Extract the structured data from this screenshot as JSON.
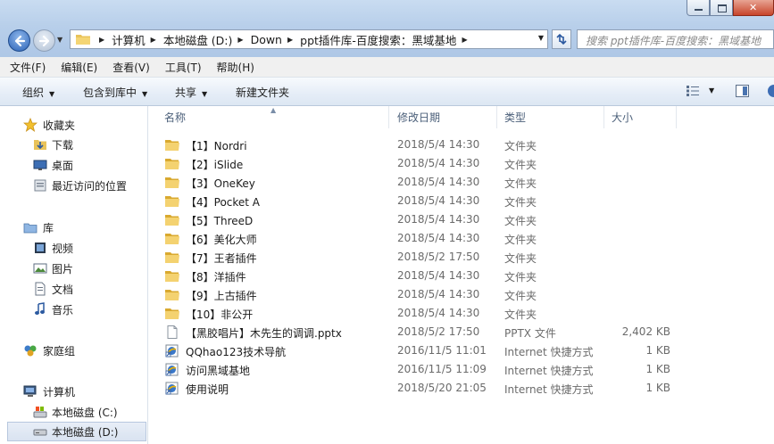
{
  "window": {
    "breadcrumb": [
      "计算机",
      "本地磁盘 (D:)",
      "Down",
      "ppt插件库-百度搜索：黑域基地"
    ],
    "search_placeholder": "搜索 ppt插件库-百度搜索：黑域基地"
  },
  "menubar": [
    "文件(F)",
    "编辑(E)",
    "查看(V)",
    "工具(T)",
    "帮助(H)"
  ],
  "toolbar": {
    "organize": "组织",
    "include_library": "包含到库中",
    "share": "共享",
    "new_folder": "新建文件夹"
  },
  "sidebar": {
    "favorites": "收藏夹",
    "downloads": "下载",
    "desktop": "桌面",
    "recent": "最近访问的位置",
    "libraries": "库",
    "videos": "视频",
    "pictures": "图片",
    "documents": "文档",
    "music": "音乐",
    "homegroup": "家庭组",
    "computer": "计算机",
    "drive_c": "本地磁盘 (C:)",
    "drive_d": "本地磁盘 (D:)"
  },
  "columns": {
    "name": "名称",
    "date": "修改日期",
    "type": "类型",
    "size": "大小"
  },
  "files": [
    {
      "name": "【1】Nordri",
      "date": "2018/5/4 14:30",
      "type": "文件夹",
      "size": "",
      "icon": "folder-icon"
    },
    {
      "name": "【2】iSlide",
      "date": "2018/5/4 14:30",
      "type": "文件夹",
      "size": "",
      "icon": "folder-icon"
    },
    {
      "name": "【3】OneKey",
      "date": "2018/5/4 14:30",
      "type": "文件夹",
      "size": "",
      "icon": "folder-icon"
    },
    {
      "name": "【4】Pocket A",
      "date": "2018/5/4 14:30",
      "type": "文件夹",
      "size": "",
      "icon": "folder-icon"
    },
    {
      "name": "【5】ThreeD",
      "date": "2018/5/4 14:30",
      "type": "文件夹",
      "size": "",
      "icon": "folder-icon"
    },
    {
      "name": "【6】美化大师",
      "date": "2018/5/4 14:30",
      "type": "文件夹",
      "size": "",
      "icon": "folder-icon"
    },
    {
      "name": "【7】王者插件",
      "date": "2018/5/2 17:50",
      "type": "文件夹",
      "size": "",
      "icon": "folder-icon"
    },
    {
      "name": "【8】洋插件",
      "date": "2018/5/4 14:30",
      "type": "文件夹",
      "size": "",
      "icon": "folder-icon"
    },
    {
      "name": "【9】上古插件",
      "date": "2018/5/4 14:30",
      "type": "文件夹",
      "size": "",
      "icon": "folder-icon"
    },
    {
      "name": "【10】非公开",
      "date": "2018/5/4 14:30",
      "type": "文件夹",
      "size": "",
      "icon": "folder-icon"
    },
    {
      "name": "【黑胶唱片】木先生的调调.pptx",
      "date": "2018/5/2 17:50",
      "type": "PPTX 文件",
      "size": "2,402 KB",
      "icon": "document-icon"
    },
    {
      "name": "QQhao123技术导航",
      "date": "2016/11/5 11:01",
      "type": "Internet 快捷方式",
      "size": "1 KB",
      "icon": "internet-shortcut-icon"
    },
    {
      "name": "访问黑域基地",
      "date": "2016/11/5 11:09",
      "type": "Internet 快捷方式",
      "size": "1 KB",
      "icon": "internet-shortcut-icon"
    },
    {
      "name": "使用说明",
      "date": "2018/5/20 21:05",
      "type": "Internet 快捷方式",
      "size": "1 KB",
      "icon": "internet-shortcut-icon"
    }
  ]
}
